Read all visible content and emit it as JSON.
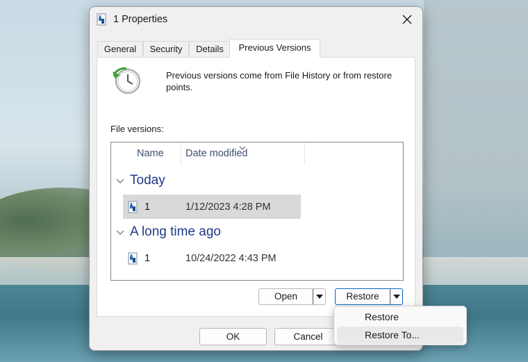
{
  "window": {
    "title": "1 Properties",
    "close_icon": "close-icon"
  },
  "tabs": [
    {
      "label": "General"
    },
    {
      "label": "Security"
    },
    {
      "label": "Details"
    },
    {
      "label": "Previous Versions",
      "active": true
    }
  ],
  "panel": {
    "intro": "Previous versions come from File History or from restore points.",
    "versions_label": "File versions:",
    "columns": {
      "name": "Name",
      "date": "Date modified"
    },
    "groups": [
      {
        "title": "Today",
        "items": [
          {
            "name": "1",
            "date": "1/12/2023 4:28 PM",
            "selected": true
          }
        ]
      },
      {
        "title": "A long time ago",
        "items": [
          {
            "name": "1",
            "date": "10/24/2022 4:43 PM",
            "selected": false
          }
        ]
      }
    ],
    "open_button": "Open",
    "restore_button": "Restore"
  },
  "footer": {
    "ok": "OK",
    "cancel": "Cancel"
  },
  "restore_menu": {
    "items": [
      {
        "label": "Restore"
      },
      {
        "label": "Restore To...",
        "highlighted": true
      }
    ]
  },
  "colors": {
    "group_header": "#1e3a8a",
    "focus_border": "#0067c0",
    "selected_row": "#d9d9d9"
  }
}
